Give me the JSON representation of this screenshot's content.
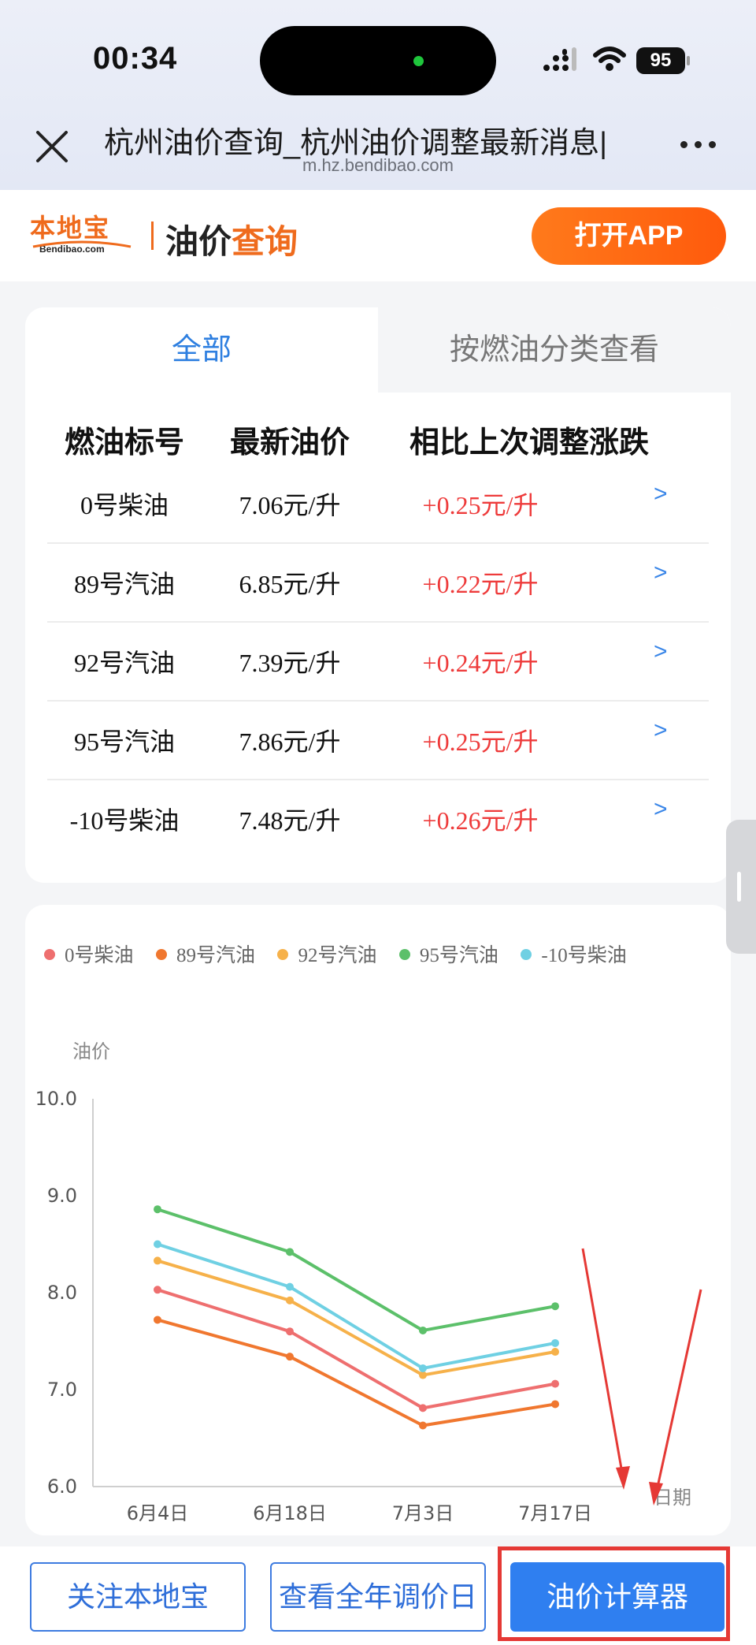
{
  "status_bar": {
    "time": "00:34",
    "battery": "95"
  },
  "browser": {
    "title": "杭州油价查询_杭州油价调整最新消息|",
    "url": "m.hz.bendibao.com",
    "close_icon": "close-icon",
    "more_icon": "more-icon"
  },
  "site": {
    "logo_text": "本地宝",
    "logo_sub": "Bendibao.com",
    "title_prefix": "油价",
    "title_accent": "查询",
    "open_app": "打开APP"
  },
  "tabs": [
    {
      "label": "全部",
      "active": true
    },
    {
      "label": "按燃油分类查看",
      "active": false
    }
  ],
  "table": {
    "headers": [
      "燃油标号",
      "最新油价",
      "相比上次调整涨跌"
    ],
    "rows": [
      {
        "fuel": "0号柴油",
        "price": "7.06元/升",
        "change": "+0.25元/升",
        "chevron": ">"
      },
      {
        "fuel": "89号汽油",
        "price": "6.85元/升",
        "change": "+0.22元/升",
        "chevron": ">"
      },
      {
        "fuel": "92号汽油",
        "price": "7.39元/升",
        "change": "+0.24元/升",
        "chevron": ">"
      },
      {
        "fuel": "95号汽油",
        "price": "7.86元/升",
        "change": "+0.25元/升",
        "chevron": ">"
      },
      {
        "fuel": "-10号柴油",
        "price": "7.48元/升",
        "change": "+0.26元/升",
        "chevron": ">"
      }
    ]
  },
  "chart_data": {
    "type": "line",
    "ylabel": "油价",
    "xlabel": "日期",
    "categories": [
      "6月4日",
      "6月18日",
      "7月3日",
      "7月17日"
    ],
    "ylim": [
      6.0,
      10.0
    ],
    "yticks": [
      "10.0",
      "9.0",
      "8.0",
      "7.0",
      "6.0"
    ],
    "grid": false,
    "legend_position": "top",
    "series": [
      {
        "name": "0号柴油",
        "color": "#ee6f6f",
        "values": [
          8.03,
          7.6,
          6.81,
          7.06
        ]
      },
      {
        "name": "89号汽油",
        "color": "#f0772f",
        "values": [
          7.72,
          7.34,
          6.63,
          6.85
        ]
      },
      {
        "name": "92号汽油",
        "color": "#f6b14a",
        "values": [
          8.33,
          7.92,
          7.15,
          7.39
        ]
      },
      {
        "name": "95号汽油",
        "color": "#5cc06a",
        "values": [
          8.86,
          8.42,
          7.61,
          7.86
        ]
      },
      {
        "name": "-10号柴油",
        "color": "#6fd0e3",
        "values": [
          8.5,
          8.06,
          7.22,
          7.48
        ]
      }
    ]
  },
  "bottom_bar": {
    "follow": "关注本地宝",
    "calendar": "查看全年调价日",
    "calculator": "油价计算器"
  },
  "colors": {
    "accent_orange": "#ef6b1d",
    "link_blue": "#2e7fe0",
    "rise_red": "#ee3b3b",
    "annotation_red": "#e53935"
  }
}
